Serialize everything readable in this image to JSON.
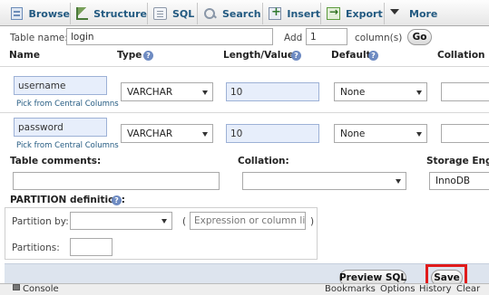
{
  "tabs": [
    {
      "label": "Browse",
      "icon": "browse-icon"
    },
    {
      "label": "Structure",
      "icon": "structure-icon"
    },
    {
      "label": "SQL",
      "icon": "sql-icon"
    },
    {
      "label": "Search",
      "icon": "search-icon"
    },
    {
      "label": "Insert",
      "icon": "insert-icon"
    },
    {
      "label": "Export",
      "icon": "export-icon"
    },
    {
      "label": "More",
      "icon": "chevron-down-icon"
    }
  ],
  "table_name": {
    "label": "Table name:",
    "value": "login"
  },
  "add_columns": {
    "label": "Add",
    "value": "1",
    "unit": "column(s)",
    "go_label": "Go"
  },
  "columns_header": {
    "name": "Name",
    "type": "Type",
    "length": "Length/Values",
    "default": "Default",
    "collation": "Collation"
  },
  "rows": [
    {
      "name": "username",
      "pick_link": "Pick from Central Columns",
      "type": "VARCHAR",
      "length": "10",
      "default": "None"
    },
    {
      "name": "password",
      "pick_link": "Pick from Central Columns",
      "type": "VARCHAR",
      "length": "10",
      "default": "None"
    }
  ],
  "table_options": {
    "comments_label": "Table comments:",
    "collation_label": "Collation:",
    "engine_label": "Storage Engi",
    "engine_value": "InnoDB"
  },
  "partition": {
    "heading": "PARTITION definition:",
    "by_label": "Partition by:",
    "open_paren": "(",
    "expr_placeholder": "Expression or column list",
    "close_paren": ")",
    "partitions_label": "Partitions:"
  },
  "actions": {
    "preview_label": "Preview SQL",
    "save_label": "Save"
  },
  "console": {
    "label": "Console",
    "links": [
      "Bookmarks",
      "Options",
      "History",
      "Clear"
    ]
  },
  "colors": {
    "accent": "#235a81",
    "highlight": "#e01b1b",
    "field_blue": "#e7eefb"
  }
}
